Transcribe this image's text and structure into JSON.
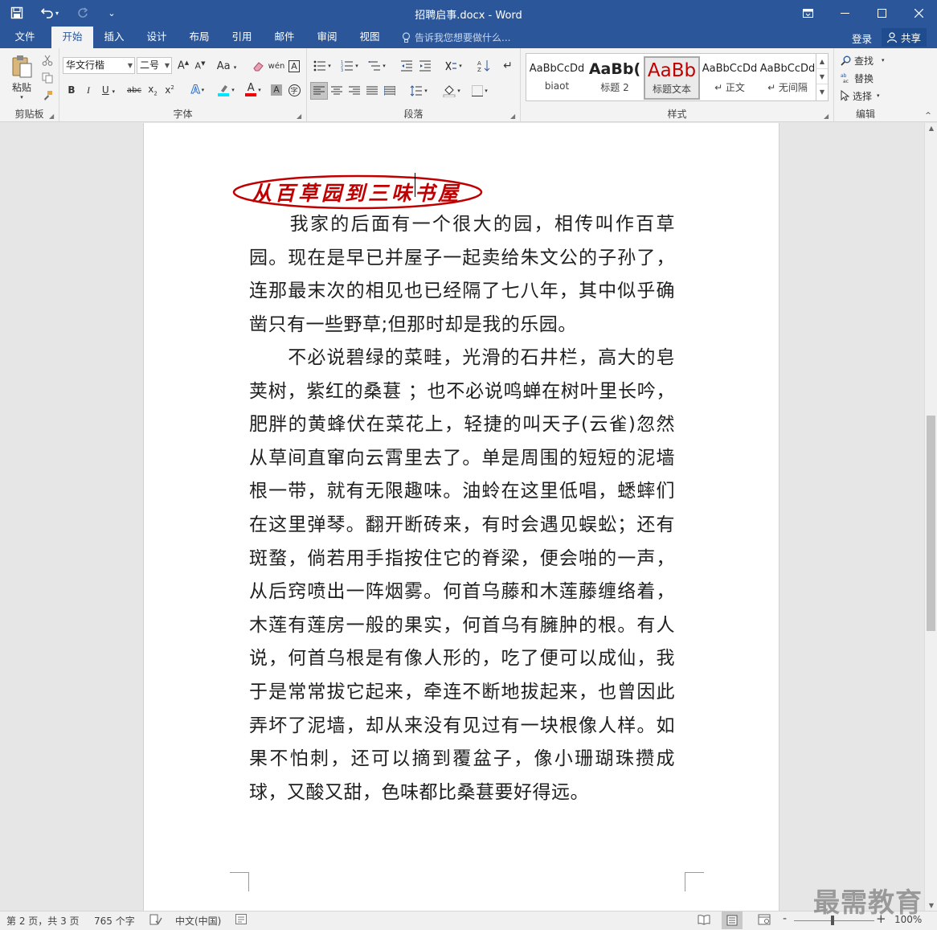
{
  "window": {
    "title": "招聘启事.docx - Word",
    "qat_menu_glyph": "⌄"
  },
  "tabs": [
    {
      "label": "文件",
      "key": "file"
    },
    {
      "label": "开始",
      "key": "home"
    },
    {
      "label": "插入",
      "key": "insert"
    },
    {
      "label": "设计",
      "key": "design"
    },
    {
      "label": "布局",
      "key": "layout"
    },
    {
      "label": "引用",
      "key": "references"
    },
    {
      "label": "邮件",
      "key": "mailings"
    },
    {
      "label": "审阅",
      "key": "review"
    },
    {
      "label": "视图",
      "key": "view"
    }
  ],
  "tellme": "告诉我您想要做什么...",
  "account": {
    "login": "登录",
    "share": "共享"
  },
  "ribbon": {
    "clipboard": {
      "label": "剪贴板",
      "paste": "粘贴"
    },
    "font": {
      "label": "字体",
      "font_name": "华文行楷",
      "font_size": "二号"
    },
    "paragraph": {
      "label": "段落"
    },
    "styles": {
      "label": "样式",
      "items": [
        {
          "preview": "AaBbCcDd",
          "name": "biaot"
        },
        {
          "preview": "AaBb(",
          "name": "标题 2"
        },
        {
          "preview": "AaBb",
          "name": "标题文本"
        },
        {
          "preview": "AaBbCcDd",
          "name": "↵ 正文"
        },
        {
          "preview": "AaBbCcDd",
          "name": "↵ 无间隔"
        }
      ]
    },
    "editing": {
      "label": "编辑",
      "find": "查找",
      "replace": "替换",
      "select": "选择"
    }
  },
  "document": {
    "heading": "从百草园到三味书屋",
    "paragraphs": [
      "　　我家的后面有一个很大的园，相传叫作百草园。现在是早已并屋子一起卖给朱文公的子孙了，连那最末次的相见也已经隔了七八年，其中似乎确凿只有一些野草;但那时却是我的乐园。",
      "　　不必说碧绿的菜畦，光滑的石井栏，高大的皂荚树，紫红的桑葚 ；也不必说鸣蝉在树叶里长吟，肥胖的黄蜂伏在菜花上，轻捷的叫天子(云雀)忽然从草间直窜向云霄里去了。单是周围的短短的泥墙根一带，就有无限趣味。油蛉在这里低唱，蟋蟀们在这里弹琴。翻开断砖来，有时会遇见蜈蚣；还有斑蝥，倘若用手指按住它的脊梁，便会啪的一声，从后窍喷出一阵烟雾。何首乌藤和木莲藤缠络着，木莲有莲房一般的果实，何首乌有臃肿的根。有人说，何首乌根是有像人形的，吃了便可以成仙，我于是常常拔它起来，牵连不断地拔起来，也曾因此弄坏了泥墙，却从来没有见过有一块根像人样。如果不怕刺，还可以摘到覆盆子，像小珊瑚珠攒成球，又酸又甜，色味都比桑葚要好得远。"
    ]
  },
  "statusbar": {
    "page": "第 2 页，共 3 页",
    "words": "765 个字",
    "language": "中文(中国)",
    "zoom": "100%",
    "zoom_minus": "-",
    "zoom_plus": "+"
  },
  "watermark": "最需教育",
  "colors": {
    "brand": "#2b579a",
    "heading_red": "#c00000",
    "ribbon_bg": "#f3f3f3"
  }
}
